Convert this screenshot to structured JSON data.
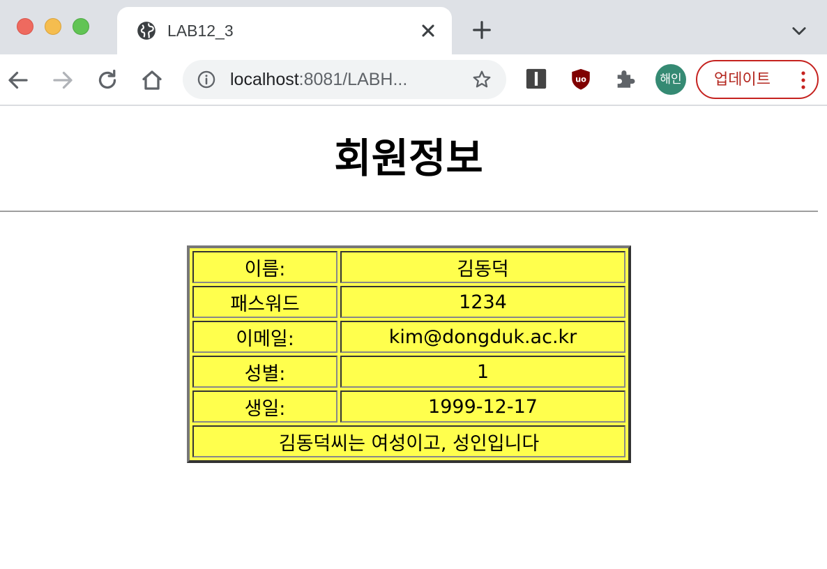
{
  "browser": {
    "tab_title": "LAB12_3",
    "url_host": "localhost",
    "url_rest": ":8081/LABH...",
    "profile_label": "해인",
    "update_label": "업데이트",
    "icons": {
      "back": "arrow-left-icon",
      "forward": "arrow-right-icon",
      "reload": "reload-icon",
      "home": "home-icon",
      "info": "info-icon",
      "star": "star-icon",
      "favicon": "globe-icon",
      "new_tab": "plus-icon",
      "close": "close-icon",
      "tab_menu": "chevron-down-icon",
      "extensions": [
        "bookmark-extension-icon",
        "ublock-icon",
        "puzzle-icon"
      ],
      "update_menu": "kebab-menu-icon"
    },
    "colors": {
      "tabstrip": "#dee1e6",
      "profile": "#358a73",
      "update_accent": "#c5221f"
    }
  },
  "page": {
    "title": "회원정보",
    "table_background": "#ffff4d",
    "rows": [
      {
        "label": "이름:",
        "value": "김동덕"
      },
      {
        "label": "패스워드",
        "value": "1234"
      },
      {
        "label": "이메일:",
        "value": "kim@dongduk.ac.kr"
      },
      {
        "label": "성별:",
        "value": "1"
      },
      {
        "label": "생일:",
        "value": "1999-12-17"
      }
    ],
    "summary": "김동덕씨는 여성이고, 성인입니다"
  }
}
